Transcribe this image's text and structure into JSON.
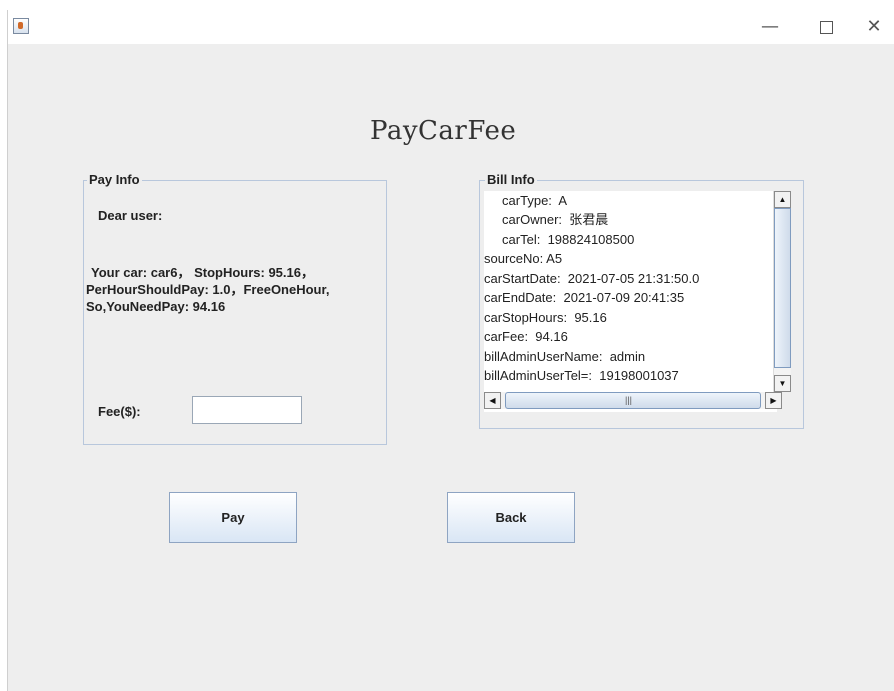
{
  "window": {
    "title_controls": {
      "minimize": "—",
      "maximize": "",
      "close": "✕"
    },
    "app_icon": "java-app-icon"
  },
  "page_title": "PayCarFee",
  "pay_info": {
    "title": "Pay Info",
    "greeting": "Dear user:",
    "message_lines": [
      "  Your car: car6， StopHours: 95.16，",
      "PerHourShouldPay: 1.0，FreeOneHour,",
      "So,YouNeedPay: 94.16"
    ],
    "fee_label": "Fee($):",
    "fee_value": ""
  },
  "bill_info": {
    "title": "Bill Info",
    "lines": [
      "     carType:  A",
      "     carOwner:  张君晨",
      "     carTel:  198824108500",
      "sourceNo: A5",
      "carStartDate:  2021-07-05 21:31:50.0",
      "carEndDate:  2021-07-09 20:41:35",
      "carStopHours:  95.16",
      "carFee:  94.16",
      "billAdminUserName:  admin",
      "billAdminUserTel=:  19198001037"
    ]
  },
  "buttons": {
    "pay": "Pay",
    "back": "Back"
  },
  "colors": {
    "background": "#eeeeee",
    "group_border": "#b8c7dc",
    "button_gradient_end": "#d9e6f5"
  },
  "icons": {
    "scroll_up": "▲",
    "scroll_down": "▼",
    "scroll_left": "◀",
    "scroll_right": "▶",
    "grip": "|||"
  }
}
